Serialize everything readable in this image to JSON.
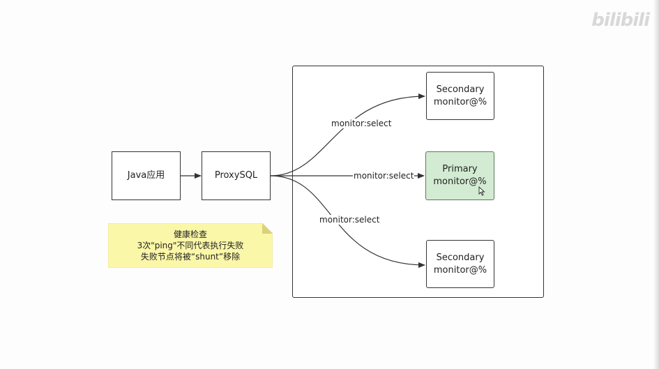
{
  "watermark": {
    "text": "bilibili"
  },
  "nodes": {
    "java": "Java应用",
    "proxysql": "ProxySQL",
    "secondary_top": {
      "line1": "Secondary",
      "line2": "monitor@%"
    },
    "primary": {
      "line1": "Primary",
      "line2": "monitor@%",
      "fill": "#d2ebd2"
    },
    "secondary_bottom": {
      "line1": "Secondary",
      "line2": "monitor@%"
    }
  },
  "edges": {
    "to_secondary_top": "monitor:select",
    "to_primary": "monitor:select",
    "to_secondary_bottom": "monitor:select"
  },
  "note": {
    "line1": "健康检查",
    "line2": "3次\"ping\"不同代表执行失败",
    "line3": "失败节点将被“shunt”移除",
    "fill": "#fbf7a8"
  }
}
